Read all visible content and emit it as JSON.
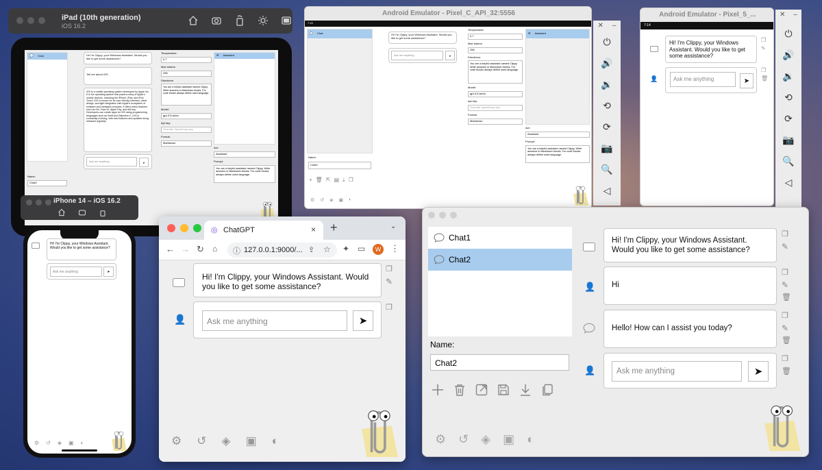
{
  "simulators": {
    "ipad": {
      "title": "iPad (10th generation)",
      "subtitle": "iOS 16.2"
    },
    "iphone": {
      "title": "iPhone 14 – iOS 16.2"
    },
    "android_tablet": {
      "title": "Android Emulator - Pixel_C_API_32:5556",
      "time": "7:15"
    },
    "android_phone": {
      "title": "Android Emulator - Pixel_5_...",
      "time": "7:14"
    }
  },
  "chat": {
    "welcome": "Hi! I'm Clippy, your Windows Assistant. Would you like to get some assistance?",
    "input_placeholder": "Ask me anything",
    "user_hi": "Hi",
    "assistant_reply": "Hello! How can I assist you today?",
    "ios_question": "Tell me about iOS.",
    "ios_answer": "iOS is a mobile operating system developed by Apple Inc. It is the operating system that powers many of Apple's mobile devices, including the iPhone, iPad, and iPod Touch. iOS is known for its user-friendly interface, sleek design, and tight integration with Apple's ecosystem of software and hardware products. It offers many features such as Siri, Face ID, Apple Pay, and AirDrop. Developers can create apps for iOS using programming languages such as Swift and Objective-C. iOS is constantly evolving, with new features and updates being released regularly."
  },
  "settings": {
    "temperature_label": "Temperature:",
    "temperature_value": "0.7",
    "max_tokens_label": "Max tokens:",
    "max_tokens_value": "256",
    "directions_label": "Directions:",
    "directions_value": "You are a helpful assistant named Clippy. Write answers in Markdown blocks. For code blocks always define used language.",
    "model_label": "Model:",
    "model_value": "gpt-3.5-turbo",
    "api_key_label": "Api key:",
    "api_key_placeholder": "Override OpenAI api key",
    "format_label": "Format:",
    "format_value": "Markdown",
    "act_label": "Act:",
    "act_value": "Assistant",
    "prompt_label": "Prompt:",
    "prompt_value": "You are a helpful assistant named Clippy. Write answers in Markdown blocks. For code blocks always define used language."
  },
  "sidebar": {
    "chats": [
      "Chat1",
      "Chat2"
    ],
    "selected_chat": "Chat2",
    "name_label": "Name:",
    "name_value": "Chat2",
    "chat_single": "Chat",
    "assistant_item": "Assistant"
  },
  "browser": {
    "tab_title": "ChatGPT",
    "url": "127.0.0.1:9000/...",
    "avatar_letter": "W"
  },
  "colors": {
    "selection_blue": "#a8ccee",
    "app_bg": "#efefef",
    "window_bg": "#ececec",
    "mac_red": "#fe5f57",
    "mac_yellow": "#febc2e",
    "mac_green": "#28c840"
  }
}
